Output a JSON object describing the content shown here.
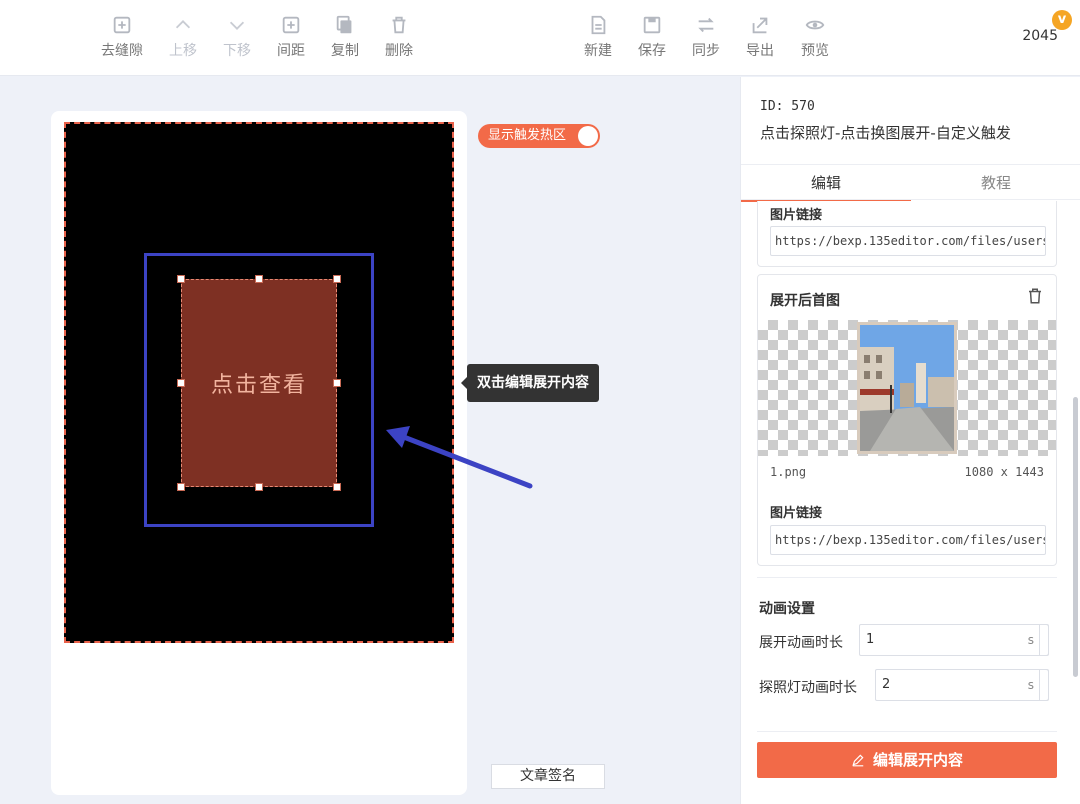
{
  "toolbar": {
    "left_buttons": [
      {
        "label": "去缝隙",
        "icon": "plus-square-icon",
        "disabled": false
      },
      {
        "label": "上移",
        "icon": "chevron-up-icon",
        "disabled": true
      },
      {
        "label": "下移",
        "icon": "chevron-down-icon",
        "disabled": true
      },
      {
        "label": "间距",
        "icon": "plus-square-icon",
        "disabled": false
      },
      {
        "label": "复制",
        "icon": "copy-icon",
        "disabled": false
      },
      {
        "label": "删除",
        "icon": "trash-icon",
        "disabled": false
      }
    ],
    "right_buttons": [
      {
        "label": "新建",
        "icon": "file-icon"
      },
      {
        "label": "保存",
        "icon": "save-icon"
      },
      {
        "label": "同步",
        "icon": "sync-icon"
      },
      {
        "label": "导出",
        "icon": "export-icon"
      },
      {
        "label": "预览",
        "icon": "eye-icon"
      }
    ],
    "score": "2045",
    "badge": "v"
  },
  "canvas": {
    "toggle_label": "显示触发热区",
    "card_text": "点击查看",
    "tooltip": "双击编辑展开内容",
    "signature_button": "文章签名"
  },
  "panel": {
    "id_text": "ID: 570",
    "title": "点击探照灯-点击换图展开-自定义触发",
    "tabs": [
      "编辑",
      "教程"
    ],
    "image_link_label": "图片链接",
    "image_link_1": "https://bexp.135editor.com/files/users/0",
    "expanded_card": {
      "title": "展开后首图",
      "file_name": "1.png",
      "dimensions": "1080 x 1443",
      "image_link_label": "图片链接",
      "image_link": "https://bexp.135editor.com/files/users/0"
    },
    "animation": {
      "title": "动画设置",
      "expand_duration_label": "展开动画时长",
      "expand_duration_value": "1",
      "spotlight_duration_label": "探照灯动画时长",
      "spotlight_duration_value": "2",
      "unit": "s"
    },
    "edit_button": "编辑展开内容"
  },
  "colors": {
    "accent": "#f26a48",
    "frame_blue": "#3c43c4",
    "card_red": "#7e3023"
  }
}
